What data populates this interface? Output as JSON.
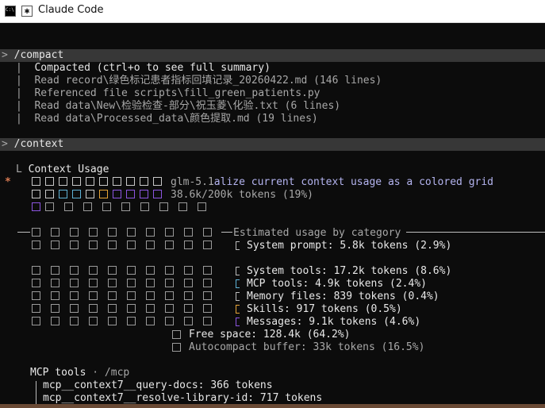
{
  "window": {
    "title": "Claude Code"
  },
  "blocks": {
    "compact": {
      "command": "/compact",
      "lines": [
        "Compacted (ctrl+o to see full summary)",
        "Read record\\绿色标记患者指标回填记录_20260422.md (146 lines)",
        "Referenced file scripts\\fill_green_patients.py",
        "Read data\\New\\检验检查-部分\\祝玉菱\\化验.txt (6 lines)",
        "Read data\\Processed_data\\颜色提取.md (19 lines)"
      ]
    },
    "context": {
      "command": "/context",
      "heading": "Context Usage",
      "model_line": "glm-5.1alize current context usage as a colored grid",
      "tokens_line": "38.6k/200k tokens (19%)",
      "category_header": "Estimated usage by category",
      "categories": [
        {
          "label": "System prompt: 5.8k tokens (2.9%)",
          "color": "#bbbbbb"
        },
        {
          "label": "System tools: 17.2k tokens (8.6%)",
          "color": "#bbbbbb"
        },
        {
          "label": "MCP tools: 4.9k tokens (2.4%)",
          "color": "#5fb2d6"
        },
        {
          "label": "Memory files: 839 tokens (0.4%)",
          "color": "#bbbbbb"
        },
        {
          "label": "Skills: 917 tokens (0.5%)",
          "color": "#e5a437"
        },
        {
          "label": "Messages: 9.1k tokens (4.6%)",
          "color": "#8c55e0"
        }
      ],
      "free_space": "Free space: 128.4k (64.2%)",
      "autocompact": "Autocompact buffer: 33k tokens (16.5%)",
      "mcp_heading": "MCP tools · /mcp",
      "mcp_items": [
        "mcp__context7__query-docs: 366 tokens",
        "mcp__context7__resolve-library-id: 717 tokens"
      ]
    }
  }
}
